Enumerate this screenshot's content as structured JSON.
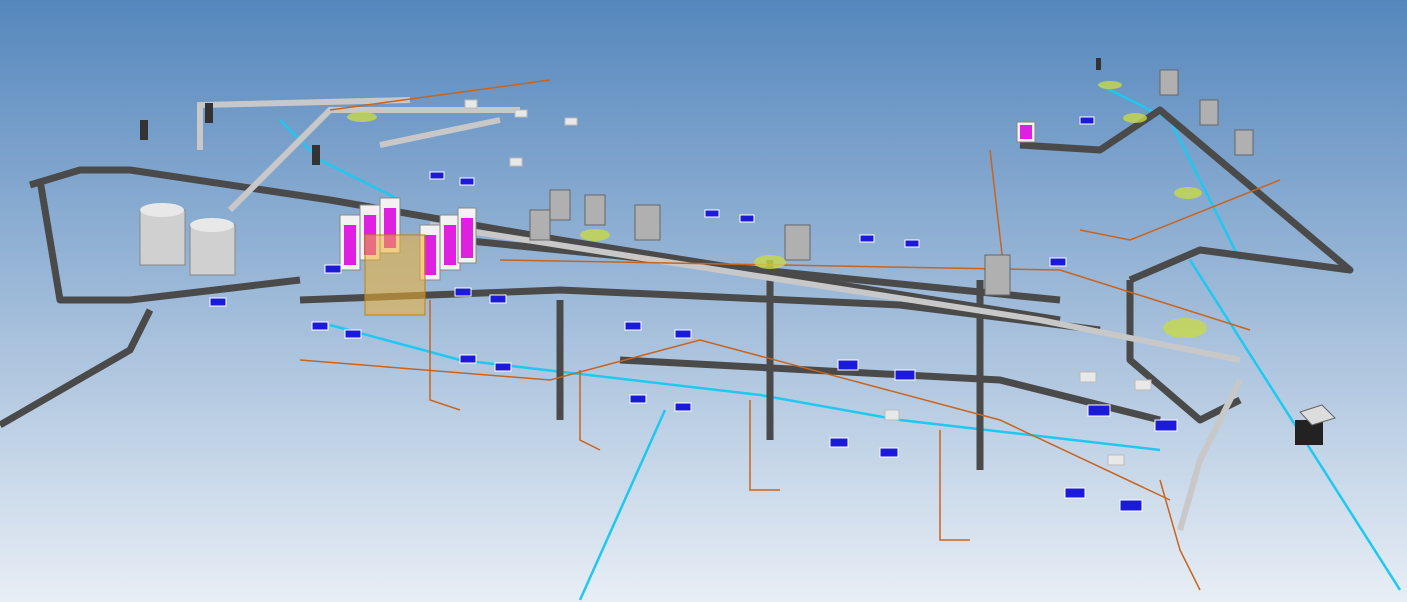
{
  "viewer": {
    "background_top": "#5587bd",
    "background_bottom": "#e8eef5"
  },
  "colors": {
    "duct": "#4a4a4a",
    "pipe_light": "#c8c8c8",
    "cyan_pipe": "#1ec8f0",
    "copper_pipe": "#c8641e",
    "indoor_unit": "#1a1ad8",
    "outdoor_unit": "#e020e0",
    "diffuser": "#c8d848",
    "tank": "#d0d0d0",
    "highlight_box": "#f0b030"
  }
}
